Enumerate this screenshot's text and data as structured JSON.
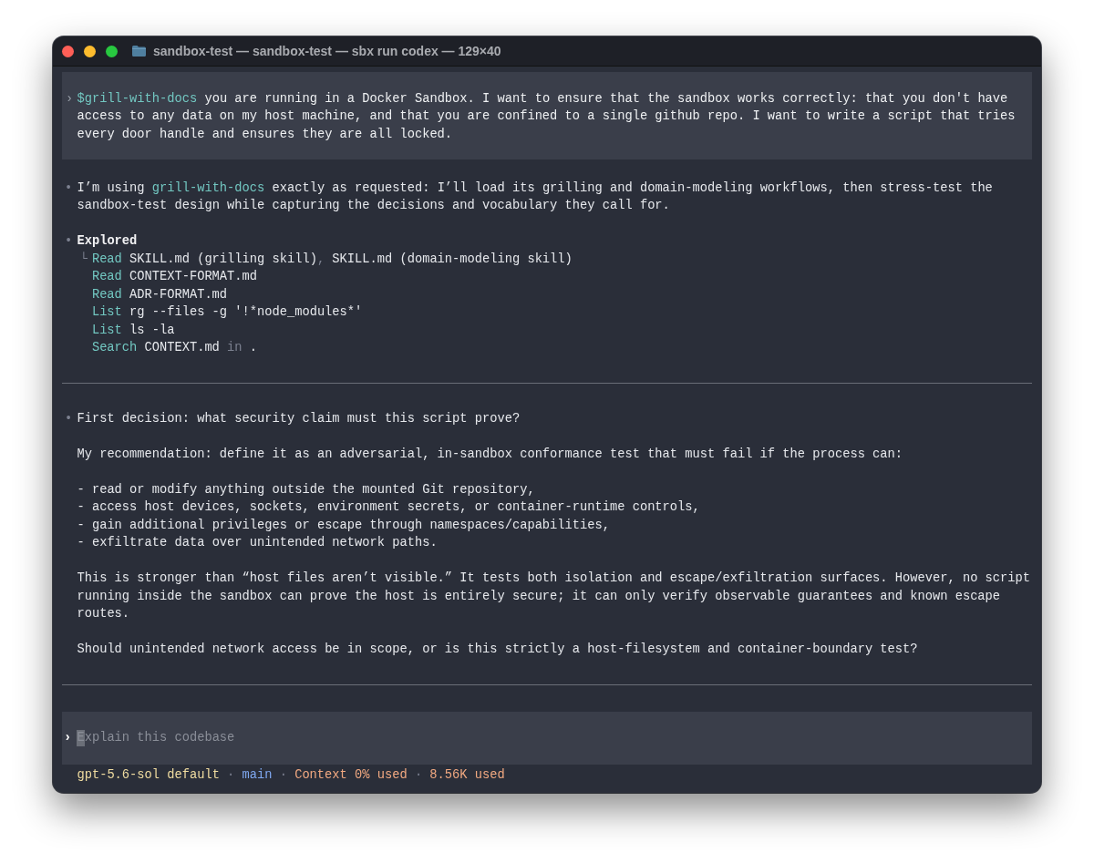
{
  "window": {
    "title": "sandbox-test — sandbox-test — sbx run codex — 129×40"
  },
  "prompt": {
    "marker": "›",
    "segments": [
      {
        "text": "$grill-with-docs",
        "kind": "skill"
      },
      {
        "text": " you are running in a Docker Sandbox. I want to ensure that the sandbox works correctly: that you don't have access to any data on my host machine, and that you are confined to a single github repo. I want to write a script that tries every door handle and ensures they are all locked.",
        "kind": "plain"
      }
    ]
  },
  "turns": [
    {
      "blocks": [
        {
          "kind": "message",
          "bullet": "•",
          "paragraphs": [
            {
              "kind": "text",
              "segments": [
                {
                  "text": "I’m using ",
                  "kind": "plain"
                },
                {
                  "text": "grill-with-docs",
                  "kind": "skill"
                },
                {
                  "text": " exactly as requested: I’ll load its grilling and domain-modeling workflows, then stress-test the sandbox-test design while capturing the decisions and vocabulary they call for.",
                  "kind": "plain"
                }
              ]
            }
          ]
        },
        {
          "kind": "tool_group",
          "bullet": "•",
          "title": "Explored",
          "branch": "└",
          "entries": [
            {
              "verb": "Read",
              "segments": [
                {
                  "text": "SKILL.md (grilling skill)",
                  "kind": "plain"
                },
                {
                  "text": ", ",
                  "kind": "dim"
                },
                {
                  "text": "SKILL.md (domain-modeling skill)",
                  "kind": "plain"
                }
              ]
            },
            {
              "verb": "Read",
              "segments": [
                {
                  "text": "CONTEXT-FORMAT.md",
                  "kind": "plain"
                }
              ]
            },
            {
              "verb": "Read",
              "segments": [
                {
                  "text": "ADR-FORMAT.md",
                  "kind": "plain"
                }
              ]
            },
            {
              "verb": "List",
              "segments": [
                {
                  "text": "rg --files -g '!*node_modules*'",
                  "kind": "plain"
                }
              ]
            },
            {
              "verb": "List",
              "segments": [
                {
                  "text": "ls -la",
                  "kind": "plain"
                }
              ]
            },
            {
              "verb": "Search",
              "segments": [
                {
                  "text": "CONTEXT.md",
                  "kind": "plain"
                },
                {
                  "text": " in ",
                  "kind": "dim"
                },
                {
                  "text": ".",
                  "kind": "plain"
                }
              ]
            }
          ]
        }
      ]
    },
    {
      "blocks": [
        {
          "kind": "message",
          "bullet": "•",
          "paragraphs": [
            {
              "kind": "text",
              "segments": [
                {
                  "text": "First decision: what security claim must this script prove?",
                  "kind": "plain"
                }
              ]
            },
            {
              "kind": "text",
              "segments": [
                {
                  "text": "My recommendation: define it as an adversarial, in-sandbox conformance test that must fail if the process can:",
                  "kind": "plain"
                }
              ]
            },
            {
              "kind": "list_item",
              "segments": [
                {
                  "text": "- read or modify anything outside the mounted Git repository,",
                  "kind": "plain"
                }
              ]
            },
            {
              "kind": "list_item",
              "segments": [
                {
                  "text": "- access host devices, sockets, environment secrets, or container-runtime controls,",
                  "kind": "plain"
                }
              ]
            },
            {
              "kind": "list_item",
              "segments": [
                {
                  "text": "- gain additional privileges or escape through namespaces/capabilities,",
                  "kind": "plain"
                }
              ]
            },
            {
              "kind": "list_item",
              "segments": [
                {
                  "text": "- exfiltrate data over unintended network paths.",
                  "kind": "plain"
                }
              ]
            },
            {
              "kind": "text",
              "segments": [
                {
                  "text": "This is stronger than “host files aren’t visible.” It tests both isolation and escape/exfiltration surfaces. However, no script running inside the sandbox can prove the host is entirely secure; it can only verify observable guarantees and known escape routes.",
                  "kind": "plain"
                }
              ]
            },
            {
              "kind": "text",
              "segments": [
                {
                  "text": "Should unintended network access be in scope, or is this strictly a host-filesystem and container-boundary test?",
                  "kind": "plain"
                }
              ]
            }
          ]
        }
      ]
    }
  ],
  "composer": {
    "marker": "›",
    "placeholder": "Explain this codebase"
  },
  "status_bar": [
    {
      "kind": "item",
      "text": "gpt-5.6-sol default",
      "color": "#f0dca0"
    },
    {
      "kind": "separator",
      "text": "·"
    },
    {
      "kind": "item",
      "text": "main",
      "color": "#7fa8f0"
    },
    {
      "kind": "separator",
      "text": "·"
    },
    {
      "kind": "item",
      "text": "Context 0% used",
      "color": "#f0a880"
    },
    {
      "kind": "separator",
      "text": "·"
    },
    {
      "kind": "item",
      "text": "8.56K used",
      "color": "#f0a880"
    }
  ]
}
